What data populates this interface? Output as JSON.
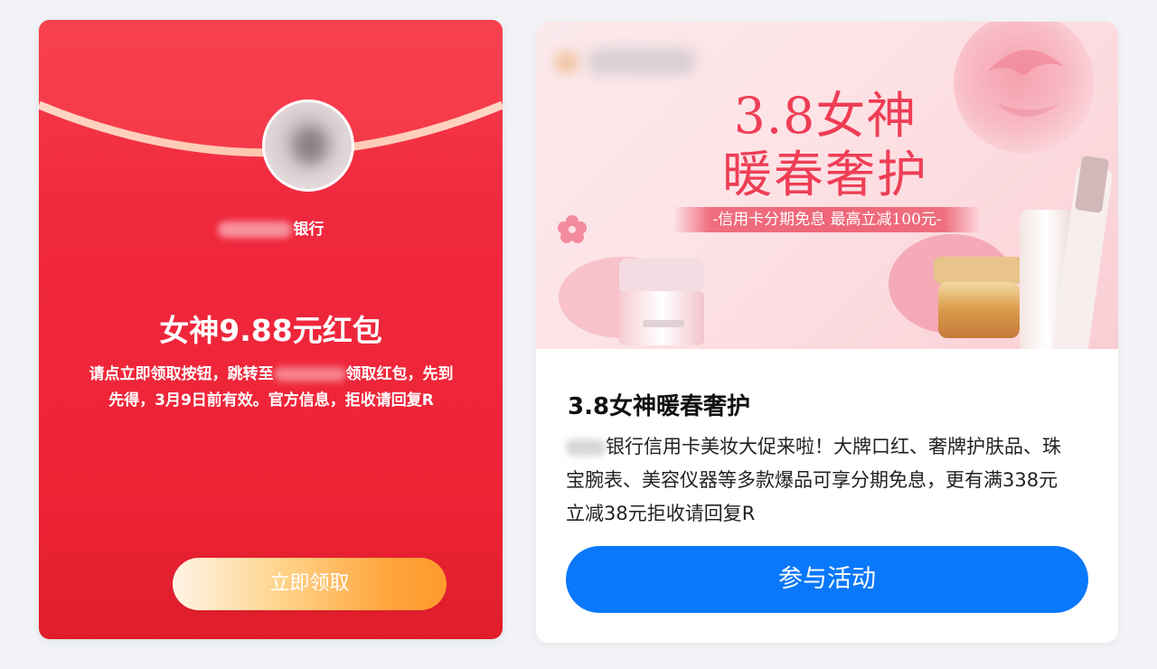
{
  "envelope": {
    "bank_suffix": "银行",
    "title": "女神9.88元红包",
    "desc_part1": "请点立即领取按钮，跳转至",
    "desc_part2": "领取红包，先到先得，3月9日前有效。官方信息，拒收请回复R",
    "button_label": "立即领取"
  },
  "promo": {
    "banner": {
      "headline_1": "3.8女神",
      "headline_2": "暖春奢护",
      "strip": "-信用卡分期免息 最高立减100元-"
    },
    "title": "3.8女神暖春奢护",
    "desc": "银行信用卡美妆大促来啦！大牌口红、奢牌护肤品、珠宝腕表、美容仪器等多款爆品可享分期免息，更有满338元立减38元拒收请回复R",
    "button_label": "参与活动"
  },
  "colors": {
    "envelope_red": "#ee2437",
    "envelope_button": "#ffa43a",
    "promo_button": "#0a78fb",
    "banner_text": "#ee3e56"
  }
}
